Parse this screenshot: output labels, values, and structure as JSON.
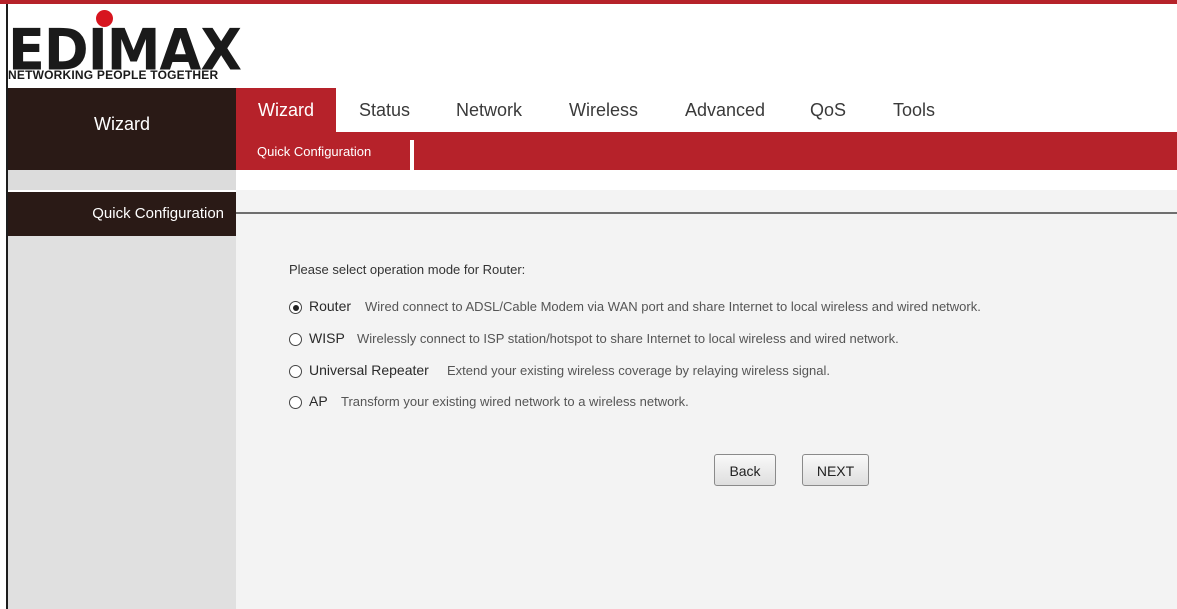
{
  "brand": {
    "logo_text": "EDIMAX",
    "tagline": "NETWORKING PEOPLE TOGETHER"
  },
  "sidebar": {
    "header": "Wizard",
    "items": [
      {
        "label": "Quick Configuration",
        "active": true
      }
    ]
  },
  "nav": {
    "tabs": [
      {
        "label": "Wizard",
        "active": true
      },
      {
        "label": "Status"
      },
      {
        "label": "Network"
      },
      {
        "label": "Wireless"
      },
      {
        "label": "Advanced"
      },
      {
        "label": "QoS"
      },
      {
        "label": "Tools"
      }
    ],
    "subtabs": [
      {
        "label": "Quick Configuration",
        "active": true
      }
    ]
  },
  "main": {
    "prompt": "Please select operation mode for Router:",
    "selected_mode": "Router",
    "options": [
      {
        "name": "Router",
        "description": "Wired connect to ADSL/Cable Modem via WAN port and share Internet to local wireless and wired network.",
        "checked": true
      },
      {
        "name": "WISP",
        "description": "Wirelessly connect to ISP station/hotspot to share Internet to local wireless and wired network.",
        "checked": false
      },
      {
        "name": "Universal Repeater",
        "description": "Extend your existing wireless coverage by relaying wireless signal.",
        "checked": false
      },
      {
        "name": "AP",
        "description": "Transform your existing wired network to a wireless network.",
        "checked": false
      }
    ],
    "back_label": "Back",
    "next_label": "NEXT"
  },
  "colors": {
    "accent_red": "#b6222a",
    "dark_brown": "#2a1a16",
    "logo_dot": "#d7151f"
  }
}
